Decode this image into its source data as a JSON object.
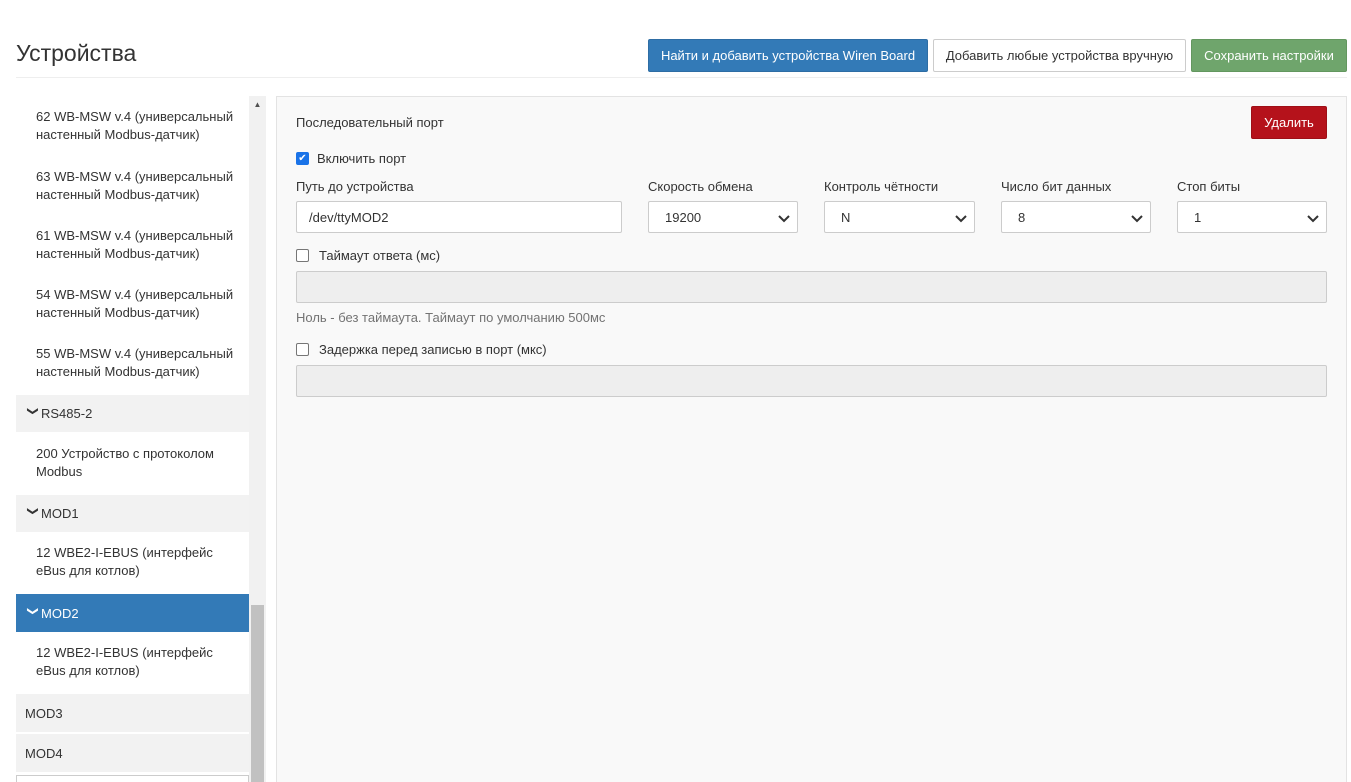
{
  "header": {
    "title": "Устройства",
    "scan_button": "Найти и добавить устройства Wiren Board",
    "add_manual_button": "Добавить любые устройства вручную",
    "save_button": "Сохранить настройки"
  },
  "sidebar": {
    "devices_top": [
      {
        "line1": "62 WB-MSW v.4 (универсальный",
        "line2": "настенный Modbus-датчик)"
      },
      {
        "line1": "63 WB-MSW v.4 (универсальный",
        "line2": "настенный Modbus-датчик)"
      },
      {
        "line1": "61 WB-MSW v.4 (универсальный",
        "line2": "настенный Modbus-датчик)"
      },
      {
        "line1": "54 WB-MSW v.4 (универсальный",
        "line2": "настенный Modbus-датчик)"
      },
      {
        "line1": "55 WB-MSW v.4 (универсальный",
        "line2": "настенный Modbus-датчик)"
      }
    ],
    "port_rs485_2": "RS485-2",
    "device_rs485_2": {
      "line1": "200 Устройство с протоколом",
      "line2": "Modbus"
    },
    "port_mod1": "MOD1",
    "device_mod1": {
      "line1": "12 WBE2-I-EBUS (интерфейс",
      "line2": "eBus для котлов)"
    },
    "port_mod2": "MOD2",
    "device_mod2": {
      "line1": "12 WBE2-I-EBUS (интерфейс",
      "line2": "eBus для котлов)"
    },
    "port_mod3": "MOD3",
    "port_mod4": "MOD4"
  },
  "panel": {
    "title": "Последовательный порт",
    "delete_button": "Удалить",
    "enable_label": "Включить порт",
    "enable_checked": true,
    "path_label": "Путь до устройства",
    "path_value": "/dev/ttyMOD2",
    "baud_label": "Скорость обмена",
    "baud_value": "19200",
    "parity_label": "Контроль чётности",
    "parity_value": "N",
    "databits_label": "Число бит данных",
    "databits_value": "8",
    "stopbits_label": "Стоп биты",
    "stopbits_value": "1",
    "timeout_label": "Таймаут ответа (мс)",
    "timeout_checked": false,
    "timeout_help": "Ноль - без таймаута. Таймаут по умолчанию 500мс",
    "delay_label": "Задержка перед записью в порт (мкс)",
    "delay_checked": false
  },
  "colors": {
    "primary": "#337ab7",
    "success": "#6fa56c",
    "danger": "#b5121b",
    "active_port": "#337ab7"
  }
}
